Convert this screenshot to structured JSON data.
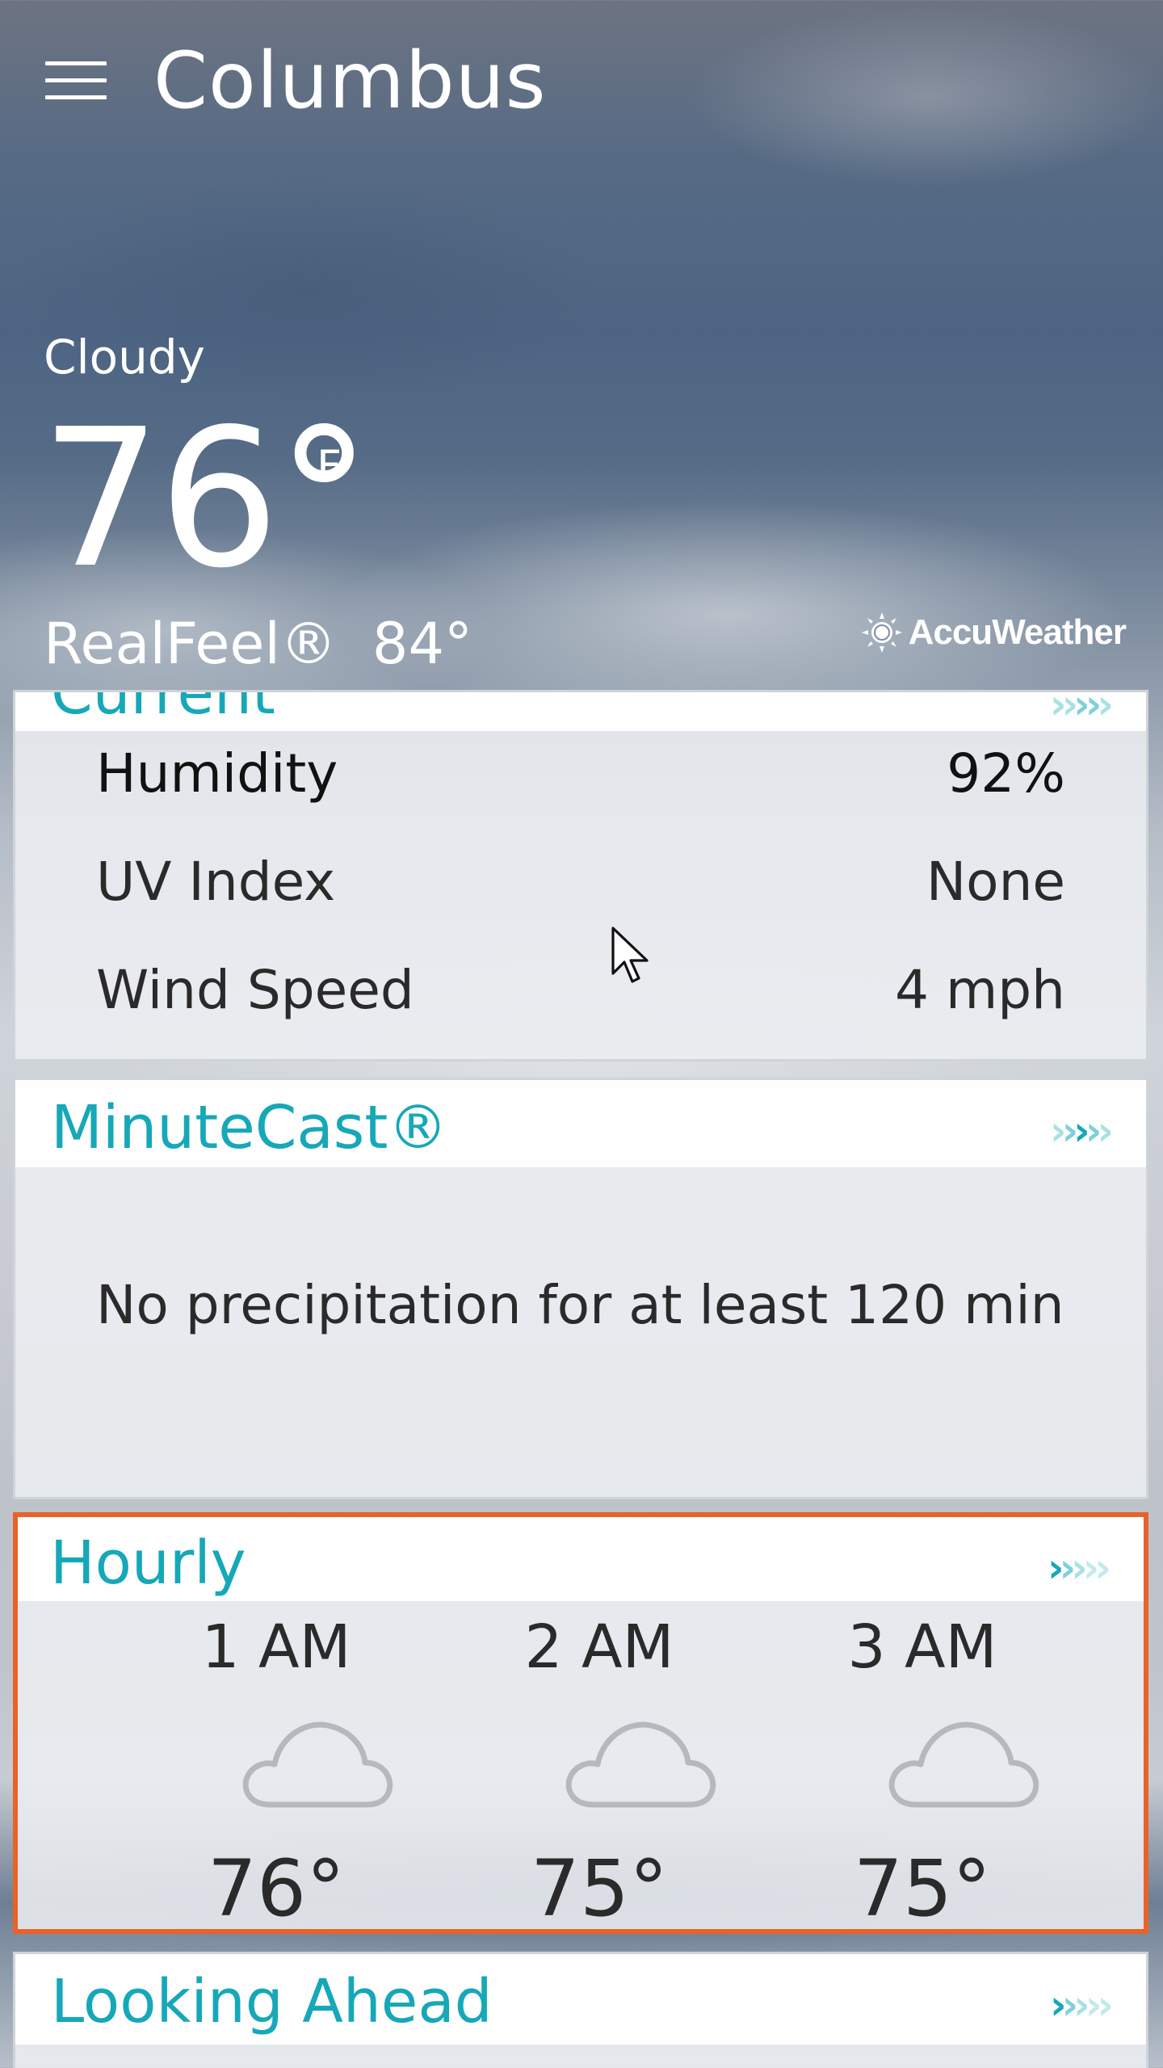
{
  "header": {
    "city": "Columbus"
  },
  "current_conditions": {
    "condition": "Cloudy",
    "temperature": "76°",
    "unit": "F",
    "realfeel_label": "RealFeel®",
    "realfeel_value": "84°",
    "provider": "AccuWeather"
  },
  "cards": {
    "current": {
      "title": "Current",
      "details": [
        {
          "label": "Humidity",
          "value": "92%"
        },
        {
          "label": "UV Index",
          "value": "None"
        },
        {
          "label": "Wind Speed",
          "value": "4 mph"
        }
      ]
    },
    "minutecast": {
      "title": "MinuteCast®",
      "message": "No precipitation for at least 120 min"
    },
    "hourly": {
      "title": "Hourly",
      "hours": [
        {
          "time": "1 AM",
          "icon": "cloud-icon",
          "temp": "76°"
        },
        {
          "time": "2 AM",
          "icon": "cloud-icon",
          "temp": "75°"
        },
        {
          "time": "3 AM",
          "icon": "cloud-icon",
          "temp": "75°"
        }
      ]
    },
    "looking_ahead": {
      "title": "Looking Ahead"
    }
  },
  "colors": {
    "accent": "#16a8b8",
    "selection_border": "#e8622a",
    "chevron_light": "#a9e0e6"
  }
}
